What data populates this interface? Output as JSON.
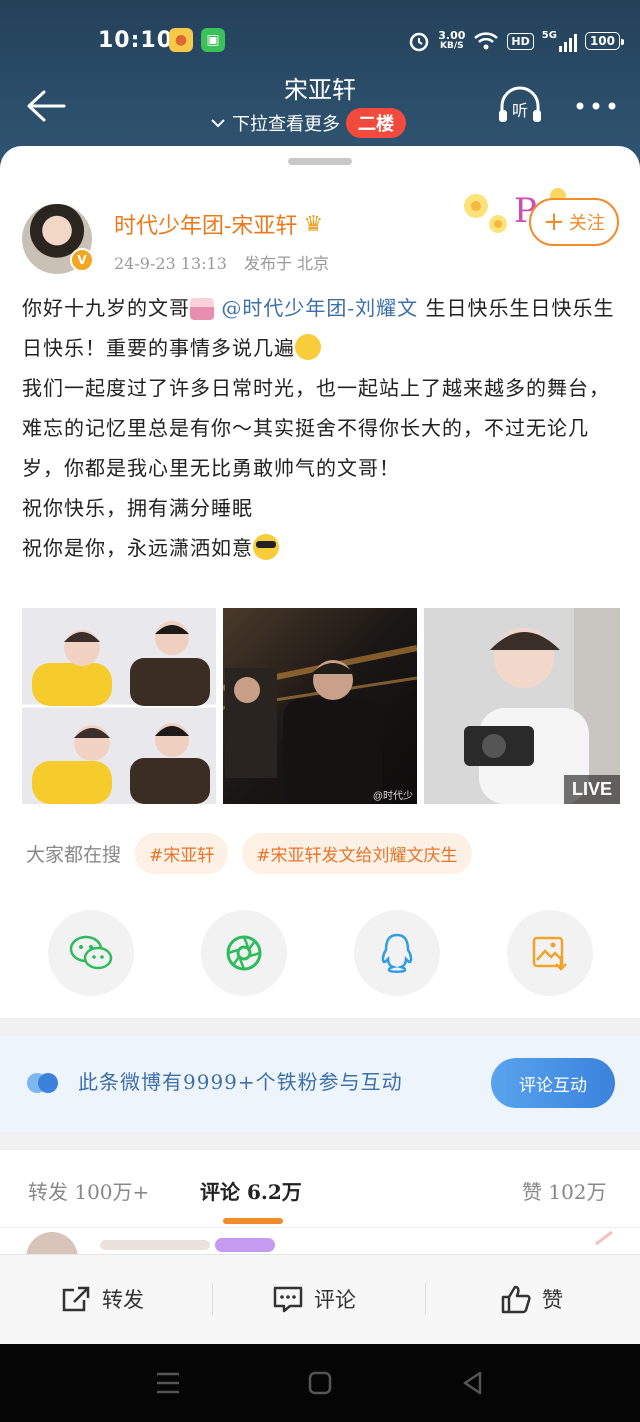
{
  "status_bar": {
    "time": "10:10",
    "net_speed": "3.00",
    "net_unit": "KB/S",
    "hd": "HD",
    "signal": "5G",
    "battery": "100"
  },
  "header": {
    "title": "宋亚轩",
    "subtitle": "下拉查看更多",
    "floor_badge": "二楼"
  },
  "post": {
    "author": "时代少年团-宋亚轩",
    "date": "24-9-23 13:13",
    "location": "发布于 北京",
    "follow_label": "关注",
    "text": {
      "p1a": "你好十九岁的文哥",
      "mention": "@时代少年团-刘耀文",
      "p1b": " 生日快乐生日快乐生日快乐！重要的事情多说几遍",
      "p2": "我们一起度过了许多日常时光，也一起站上了越来越多的舞台，难忘的记忆里总是有你～其实挺舍不得你长大的，不过无论几岁，你都是我心里无比勇敢帅气的文哥！",
      "p3": "祝你快乐，拥有满分睡眠",
      "p4": "祝你是你，永远潇洒如意"
    },
    "images": [
      {
        "icon": "photo-grid-yellow-hoodies"
      },
      {
        "icon": "photo-night-street",
        "watermark": "@时代少"
      },
      {
        "icon": "photo-camera",
        "badge": "LIVE"
      }
    ]
  },
  "search": {
    "label": "大家都在搜",
    "tags": [
      "#宋亚轩",
      "#宋亚轩发文给刘耀文庆生"
    ]
  },
  "share_icons": [
    "wechat-icon",
    "moments-icon",
    "qq-icon",
    "save-image-icon"
  ],
  "fan_banner": {
    "text": "此条微博有9999+个铁粉参与互动",
    "button": "评论互动"
  },
  "tabs": {
    "repost_label": "转发",
    "repost_count": "100万+",
    "comment_label": "评论",
    "comment_count": "6.2万",
    "like_label": "赞",
    "like_count": "102万"
  },
  "actions": {
    "repost": "转发",
    "comment": "评论",
    "like": "赞"
  },
  "colors": {
    "accent": "#f28c2a",
    "link": "#3d6fa9",
    "header_bg": "#2c4a63"
  }
}
